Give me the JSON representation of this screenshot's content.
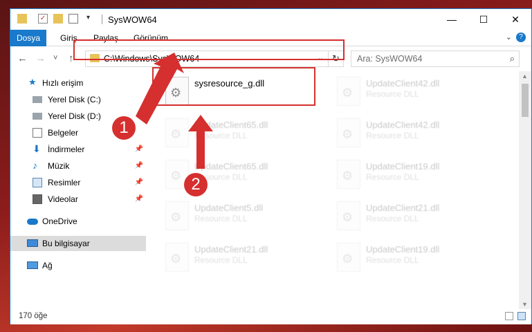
{
  "window": {
    "title": "SysWOW64",
    "controls": {
      "minimize": "—",
      "maximize": "☐",
      "close": "✕"
    }
  },
  "ribbon": {
    "tabs": [
      "Dosya",
      "Giriş",
      "Paylaş",
      "Görünüm"
    ]
  },
  "nav": {
    "back": "←",
    "forward": "→",
    "recent": "˅",
    "up": "↑",
    "address": "C:\\Windows\\SysWOW64",
    "search_placeholder": "Ara: SysWOW64"
  },
  "sidebar": {
    "items": [
      {
        "label": "Hızlı erişim",
        "icon": "star-icon"
      },
      {
        "label": "Yerel Disk (C:)",
        "icon": "drive-icon"
      },
      {
        "label": "Yerel Disk (D:)",
        "icon": "drive-icon"
      },
      {
        "label": "Belgeler",
        "icon": "documents-icon"
      },
      {
        "label": "İndirmeler",
        "icon": "download-icon"
      },
      {
        "label": "Müzik",
        "icon": "music-icon"
      },
      {
        "label": "Resimler",
        "icon": "pictures-icon"
      },
      {
        "label": "Videolar",
        "icon": "video-icon"
      },
      {
        "label": "OneDrive",
        "icon": "cloud-icon"
      },
      {
        "label": "Bu bilgisayar",
        "icon": "computer-icon"
      },
      {
        "label": "Ağ",
        "icon": "network-icon"
      }
    ]
  },
  "files": [
    {
      "name": "sysresource_g.dll",
      "type": "",
      "faded": false
    },
    {
      "name": "UpdateClient42.dll",
      "type": "Resource DLL",
      "faded": true
    },
    {
      "name": "UpdateClient65.dll",
      "type": "Resource DLL",
      "faded": true
    },
    {
      "name": "UpdateClient42.dll",
      "type": "Resource DLL",
      "faded": true
    },
    {
      "name": "UpdateClient65.dll",
      "type": "Resource DLL",
      "faded": true
    },
    {
      "name": "UpdateClient19.dll",
      "type": "Resource DLL",
      "faded": true
    },
    {
      "name": "UpdateClient5.dll",
      "type": "Resource DLL",
      "faded": true
    },
    {
      "name": "UpdateClient21.dll",
      "type": "Resource DLL",
      "faded": true
    },
    {
      "name": "UpdateClient21.dll",
      "type": "Resource DLL",
      "faded": true
    },
    {
      "name": "UpdateClient19.dll",
      "type": "Resource DLL",
      "faded": true
    }
  ],
  "status": {
    "count": "170 öğe"
  },
  "markers": [
    "1",
    "2"
  ],
  "colors": {
    "accent": "#1979ca",
    "highlight": "#d62f2f"
  }
}
